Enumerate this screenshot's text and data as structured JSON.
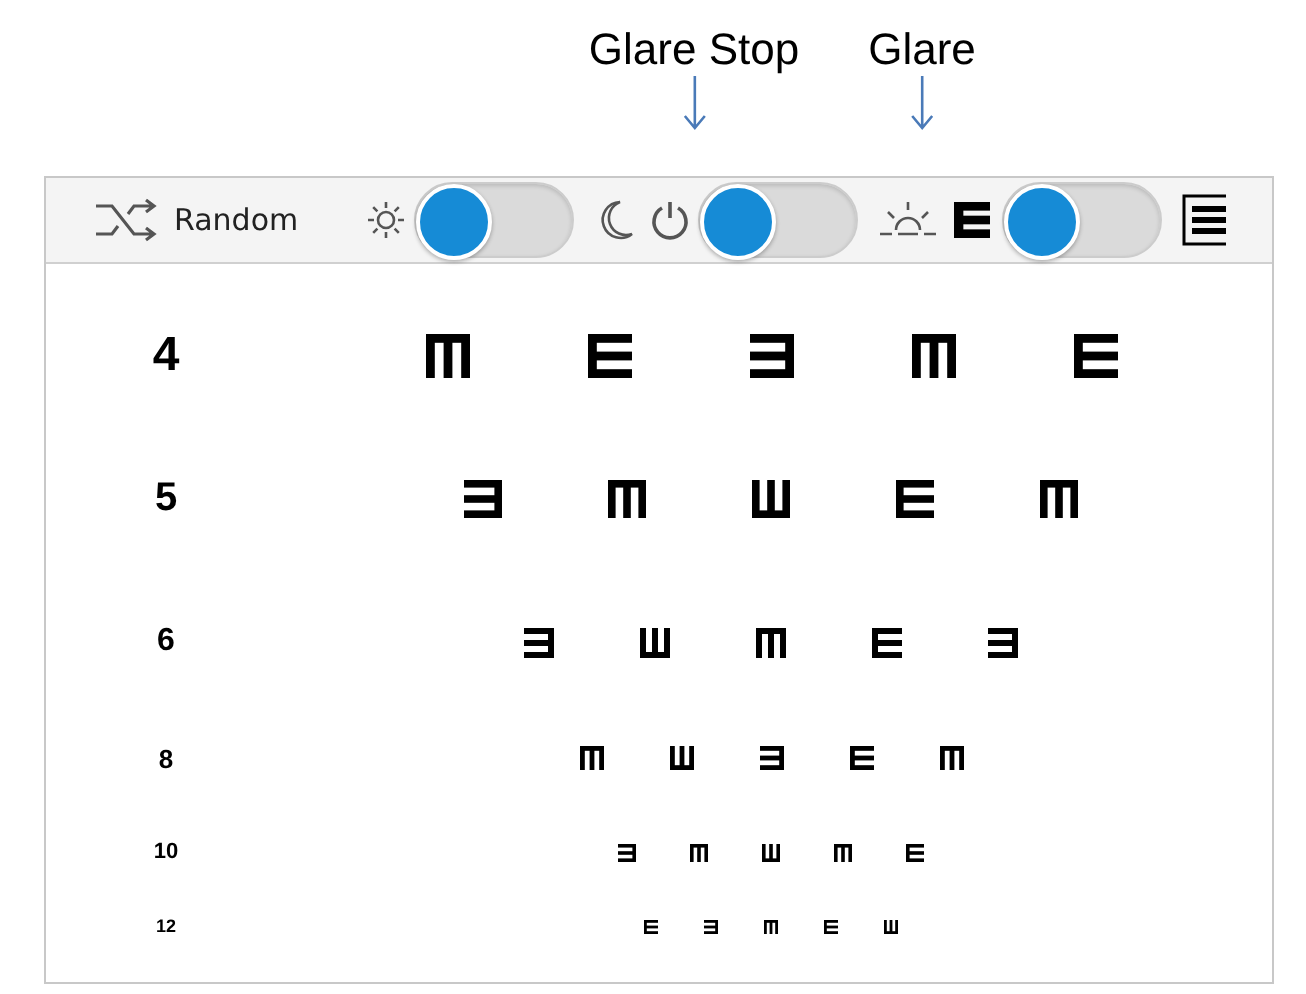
{
  "callouts": [
    {
      "label": "Glare Stop"
    },
    {
      "label": "Glare"
    }
  ],
  "toolbar": {
    "random_button": {
      "label": "Random"
    },
    "toggles": [
      {
        "on": false
      },
      {
        "on": false
      },
      {
        "on": false
      }
    ]
  },
  "chart_rows": [
    {
      "label": "4",
      "optotypes": [
        {
          "kind": "down"
        },
        {
          "kind": "right"
        },
        {
          "kind": "left"
        },
        {
          "kind": "down"
        },
        {
          "kind": "right"
        }
      ]
    },
    {
      "label": "5",
      "optotypes": [
        {
          "kind": "left"
        },
        {
          "kind": "down"
        },
        {
          "kind": "up"
        },
        {
          "kind": "right"
        },
        {
          "kind": "down"
        }
      ]
    },
    {
      "label": "6",
      "optotypes": [
        {
          "kind": "left"
        },
        {
          "kind": "up"
        },
        {
          "kind": "down"
        },
        {
          "kind": "right"
        },
        {
          "kind": "left"
        }
      ]
    },
    {
      "label": "8",
      "optotypes": [
        {
          "kind": "down"
        },
        {
          "kind": "up"
        },
        {
          "kind": "left"
        },
        {
          "kind": "right"
        },
        {
          "kind": "down"
        }
      ]
    },
    {
      "label": "10",
      "optotypes": [
        {
          "kind": "left"
        },
        {
          "kind": "down"
        },
        {
          "kind": "up"
        },
        {
          "kind": "down"
        },
        {
          "kind": "right"
        }
      ]
    },
    {
      "label": "12",
      "optotypes": [
        {
          "kind": "right"
        },
        {
          "kind": "left"
        },
        {
          "kind": "down"
        },
        {
          "kind": "right"
        },
        {
          "kind": "up"
        }
      ]
    }
  ]
}
